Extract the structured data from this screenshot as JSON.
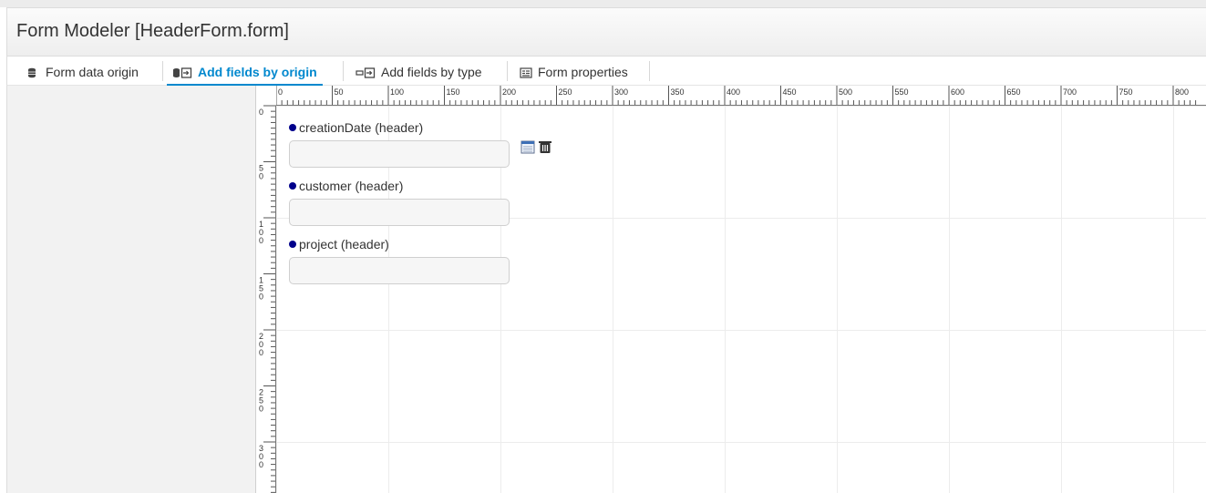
{
  "window": {
    "title": "Form Modeler [HeaderForm.form]"
  },
  "tabs": [
    {
      "label": "Form data origin",
      "icon": "database-icon",
      "active": false
    },
    {
      "label": "Add fields by origin",
      "icon": "database-add-icon",
      "active": true
    },
    {
      "label": "Add fields by type",
      "icon": "field-add-icon",
      "active": false
    },
    {
      "label": "Form properties",
      "icon": "properties-icon",
      "active": false
    }
  ],
  "rulers": {
    "horizontal": [
      "0",
      "50",
      "100",
      "150",
      "200",
      "250",
      "300",
      "350",
      "400",
      "450",
      "500",
      "550",
      "600",
      "650",
      "700",
      "750",
      "800"
    ],
    "vertical": [
      "0",
      "50",
      "100",
      "150",
      "200",
      "250",
      "300"
    ]
  },
  "fields": [
    {
      "label": "creationDate (header)",
      "value": ""
    },
    {
      "label": "customer (header)",
      "value": ""
    },
    {
      "label": "project (header)",
      "value": ""
    }
  ],
  "field_tools": {
    "icons": [
      "edit-icon",
      "delete-icon"
    ]
  },
  "colors": {
    "accent": "#0088ce",
    "field_dot": "#00008b"
  }
}
